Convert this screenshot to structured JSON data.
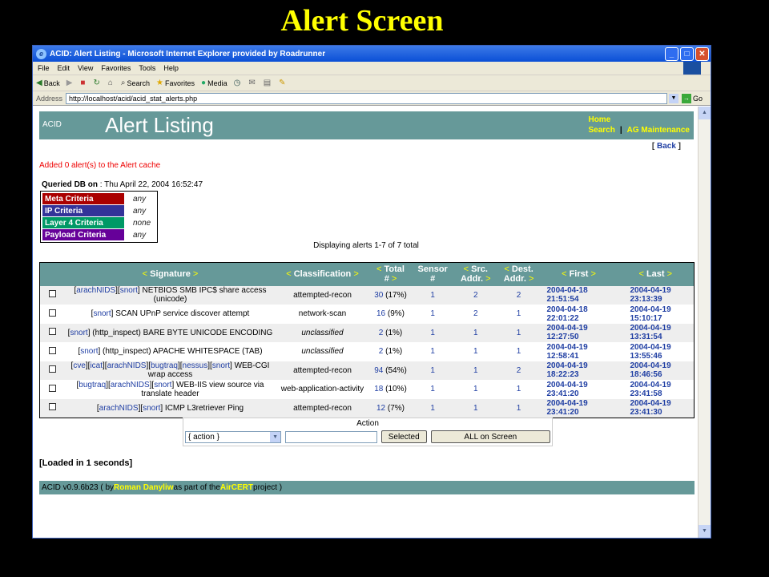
{
  "slide": {
    "title": "Alert Screen"
  },
  "window": {
    "title": "ACID: Alert Listing - Microsoft Internet Explorer provided by Roadrunner",
    "minimize": "_",
    "maximize": "□",
    "close": "✕"
  },
  "menubar": [
    "File",
    "Edit",
    "View",
    "Favorites",
    "Tools",
    "Help"
  ],
  "toolbar": {
    "back": "Back",
    "search": "Search",
    "favorites": "Favorites",
    "media": "Media"
  },
  "address": {
    "label": "Address",
    "url": "http://localhost/acid/acid_stat_alerts.php",
    "go": "Go"
  },
  "header": {
    "brand": "ACID",
    "title": "Alert Listing",
    "home": "Home",
    "search": "Search",
    "sep": "|",
    "maint": "AG Maintenance"
  },
  "back_link": {
    "open": "[ ",
    "label": "Back",
    "close": " ]"
  },
  "cache_msg": "Added 0 alert(s) to the Alert cache",
  "queried": {
    "label": "Queried DB on",
    "value": " : Thu April 22, 2004 16:52:47"
  },
  "criteria": [
    {
      "name": "Meta Criteria",
      "value": "any",
      "color": "#aa0000"
    },
    {
      "name": "IP Criteria",
      "value": "any",
      "color": "#333399"
    },
    {
      "name": "Layer 4 Criteria",
      "value": "none",
      "color": "#009966"
    },
    {
      "name": "Payload Criteria",
      "value": "any",
      "color": "#660099"
    }
  ],
  "displaying": "Displaying alerts 1-7 of 7 total",
  "columns": {
    "signature": "Signature",
    "classification": "Classification",
    "total_a": "Total",
    "total_b": "#",
    "sensor_a": "Sensor",
    "sensor_b": "#",
    "src_a": "Src.",
    "src_b": "Addr.",
    "dst_a": "Dest.",
    "dst_b": "Addr.",
    "first": "First",
    "last": "Last",
    "lt": "<",
    "gt": ">"
  },
  "rows": [
    {
      "tags": [
        "arachNIDS",
        "snort"
      ],
      "sig": "NETBIOS SMB IPC$ share access (unicode)",
      "classification": "attempted-recon",
      "unclassified": false,
      "total": "30",
      "pct": "(17%)",
      "sensor": "1",
      "src": "2",
      "dst": "2",
      "first_d": "2004-04-18",
      "first_t": "21:51:54",
      "last_d": "2004-04-19",
      "last_t": "23:13:39"
    },
    {
      "tags": [
        "snort"
      ],
      "sig": "SCAN UPnP service discover attempt",
      "classification": "network-scan",
      "unclassified": false,
      "total": "16",
      "pct": "(9%)",
      "sensor": "1",
      "src": "2",
      "dst": "1",
      "first_d": "2004-04-18",
      "first_t": "22:01:22",
      "last_d": "2004-04-19",
      "last_t": "15:10:17"
    },
    {
      "tags": [
        "snort"
      ],
      "sig": "(http_inspect) BARE BYTE UNICODE ENCODING",
      "classification": "unclassified",
      "unclassified": true,
      "total": "2",
      "pct": "(1%)",
      "sensor": "1",
      "src": "1",
      "dst": "1",
      "first_d": "2004-04-19",
      "first_t": "12:27:50",
      "last_d": "2004-04-19",
      "last_t": "13:31:54"
    },
    {
      "tags": [
        "snort"
      ],
      "sig": "(http_inspect) APACHE WHITESPACE (TAB)",
      "classification": "unclassified",
      "unclassified": true,
      "total": "2",
      "pct": "(1%)",
      "sensor": "1",
      "src": "1",
      "dst": "1",
      "first_d": "2004-04-19",
      "first_t": "12:58:41",
      "last_d": "2004-04-19",
      "last_t": "13:55:46"
    },
    {
      "tags": [
        "cve",
        "icat",
        "arachNIDS",
        "bugtraq",
        "nessus",
        "snort"
      ],
      "sig": "WEB-CGI wrap access",
      "classification": "attempted-recon",
      "unclassified": false,
      "total": "94",
      "pct": "(54%)",
      "sensor": "1",
      "src": "1",
      "dst": "2",
      "first_d": "2004-04-19",
      "first_t": "18:22:23",
      "last_d": "2004-04-19",
      "last_t": "18:46:56"
    },
    {
      "tags": [
        "bugtraq",
        "arachNIDS",
        "snort"
      ],
      "sig": "WEB-IIS view source via translate header",
      "classification": "web-application-activity",
      "unclassified": false,
      "total": "18",
      "pct": "(10%)",
      "sensor": "1",
      "src": "1",
      "dst": "1",
      "first_d": "2004-04-19",
      "first_t": "23:41:20",
      "last_d": "2004-04-19",
      "last_t": "23:41:58"
    },
    {
      "tags": [
        "arachNIDS",
        "snort"
      ],
      "sig": "ICMP L3retriever Ping",
      "classification": "attempted-recon",
      "unclassified": false,
      "total": "12",
      "pct": "(7%)",
      "sensor": "1",
      "src": "1",
      "dst": "1",
      "first_d": "2004-04-19",
      "first_t": "23:41:20",
      "last_d": "2004-04-19",
      "last_t": "23:41:30"
    }
  ],
  "action": {
    "title": "Action",
    "select": "{ action }",
    "selected": "Selected",
    "all": "ALL on Screen"
  },
  "loaded": "[Loaded in 1 seconds]",
  "footer": {
    "pre": "ACID v0.9.6b23 ( by ",
    "author": "Roman Danyliw",
    "mid": " as part of the ",
    "project": "AirCERT",
    "post": " project )"
  }
}
